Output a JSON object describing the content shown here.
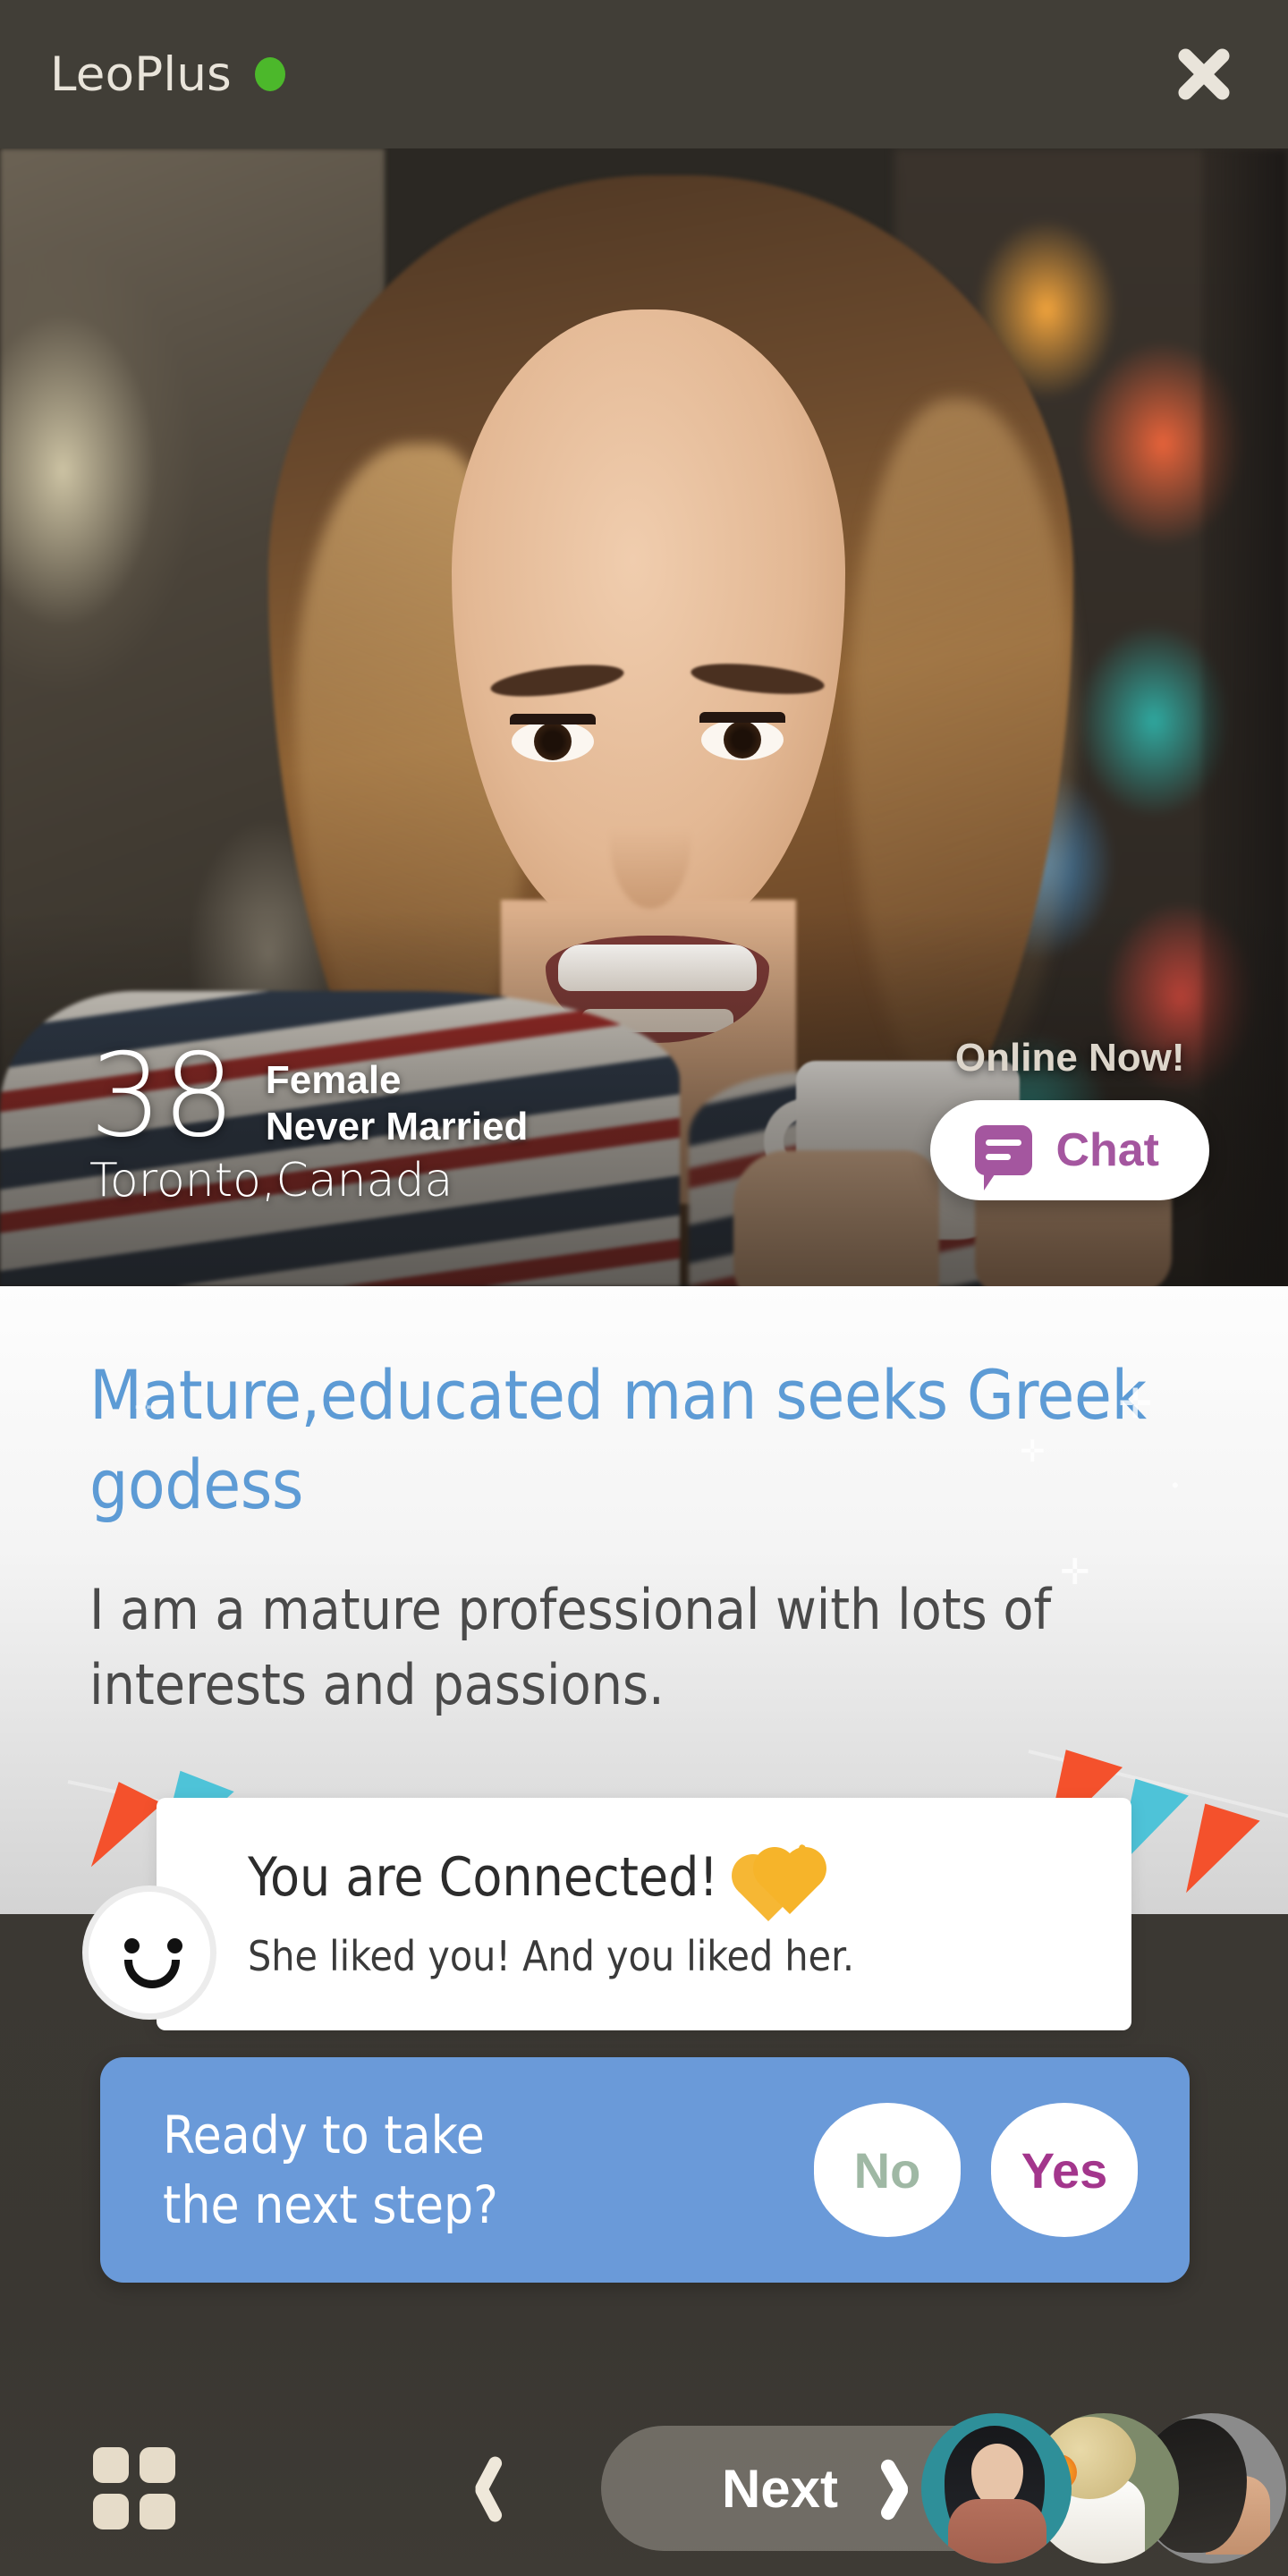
{
  "header": {
    "brand": "LeoPlus",
    "online_dot_color": "#4cb82b",
    "close_label": "×"
  },
  "profile": {
    "age": "38",
    "gender": "Female",
    "marital_status": "Never Married",
    "location": "Toronto,Canada",
    "online_status": "Online Now!",
    "chat_label": "Chat",
    "chat_accent_color": "#a4569f"
  },
  "content": {
    "headline": "Mature,educated man seeks Greek godess",
    "bio": "I am a mature professional with lots of interests and passions.",
    "headline_color": "#5d9bd5"
  },
  "connected": {
    "title": "You are Connected!",
    "subtitle": "She liked you! And you liked her.",
    "hearts_icon": "two-hearts-icon",
    "avatar_icon": "smiley-face-icon"
  },
  "prompt": {
    "question_line1": "Ready to take",
    "question_line2": "the next step?",
    "no_label": "No",
    "yes_label": "Yes",
    "bar_color": "#6a9ad9",
    "no_color": "#9fb8a4",
    "yes_color": "#a3368c"
  },
  "bottom_nav": {
    "grid_icon": "grid-view-icon",
    "prev_icon": "chevron-left-icon",
    "next_label": "Next",
    "next_icon": "chevron-right-icon",
    "avatar_count": "3"
  },
  "confetti": {
    "teal": "#4ec3d8",
    "orange": "#f4512c"
  }
}
